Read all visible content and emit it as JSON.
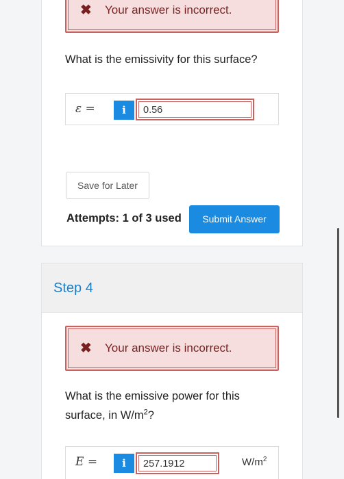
{
  "top": {
    "alert_text": "Your answer is incorrect.",
    "question": "What is the emissivity for this surface?",
    "symbol": "ε =",
    "info_label": "i",
    "answer_value": "0.56",
    "save_label": "Save for Later",
    "attempts": "Attempts: 1 of 3 used",
    "submit_label": "Submit Answer"
  },
  "step4": {
    "title": "Step 4",
    "alert_text": "Your answer is incorrect.",
    "question_line1": "What is the emissive power for this",
    "question_line2_pre": "surface, in W/m",
    "question_line2_sup": "2",
    "question_line2_post": "?",
    "symbol": "E =",
    "info_label": "i",
    "answer_value": "257.1912",
    "unit_base": "W/m",
    "unit_sup": "2"
  },
  "icons": {
    "alert": "x-mark-icon",
    "info": "info-icon"
  },
  "colors": {
    "accent": "#1a8be0",
    "error_bg": "#f6dede",
    "error_border": "#c9625f",
    "error_text": "#7a1f1f"
  }
}
